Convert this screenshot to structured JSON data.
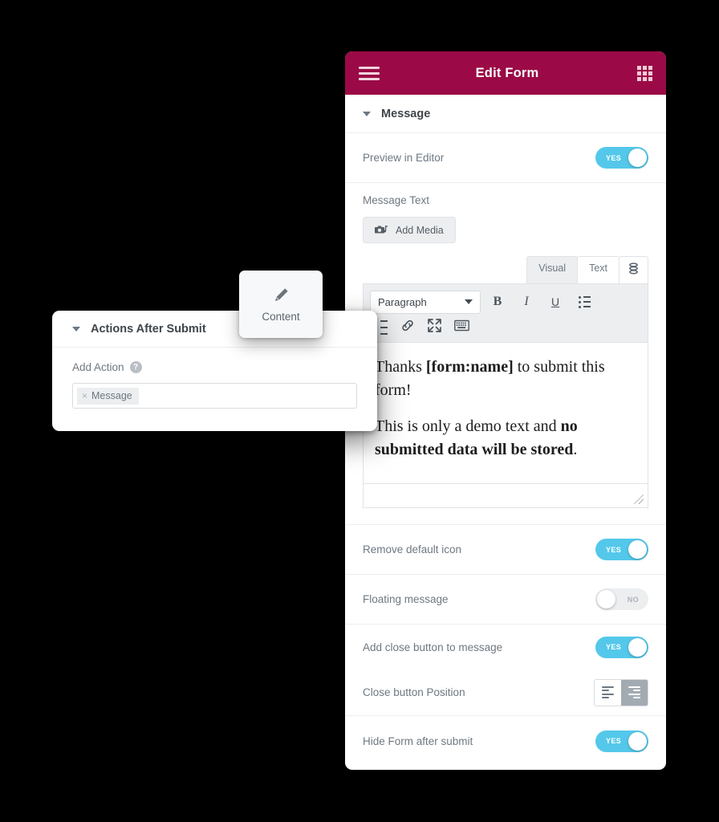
{
  "panel": {
    "header": {
      "title": "Edit Form",
      "menu_icon": "hamburger-icon",
      "apps_icon": "grid-icon",
      "bg_color": "#9b0a46"
    },
    "section": {
      "label": "Message",
      "expanded": true
    },
    "rows": {
      "preview_in_editor": {
        "label": "Preview in Editor",
        "toggle": "YES",
        "state": "on"
      },
      "remove_default_icon": {
        "label": "Remove default icon",
        "toggle": "YES",
        "state": "on"
      },
      "floating_message": {
        "label": "Floating message",
        "toggle": "NO",
        "state": "off"
      },
      "add_close_button": {
        "label": "Add close button to message",
        "toggle": "YES",
        "state": "on"
      },
      "close_button_position": {
        "label": "Close button Position",
        "options": [
          "align-left",
          "align-right"
        ],
        "selected": "align-right"
      },
      "hide_form_after_submit": {
        "label": "Hide Form after submit",
        "toggle": "YES",
        "state": "on"
      }
    },
    "message_text": {
      "label": "Message Text",
      "add_media_label": "Add Media",
      "add_media_icon": "camera-music-icon",
      "tabs": [
        {
          "label": "Visual",
          "active": true
        },
        {
          "label": "Text",
          "active": false
        }
      ],
      "database_tab_icon": "database-icon",
      "toolbar": {
        "format_select": "Paragraph",
        "bold": "B",
        "italic": "I",
        "underline": "U",
        "bullet_list_icon": "unordered-list-icon",
        "numbered_list_icon": "ordered-list-icon",
        "link_icon": "link-icon",
        "fullscreen_icon": "fullscreen-icon",
        "keyboard_icon": "keyboard-icon"
      },
      "content": {
        "paragraph_1_a": "Thanks ",
        "paragraph_1_b": "[form:name]",
        "paragraph_1_c": " to submit this form!",
        "paragraph_2_a": "This is only a demo text and ",
        "paragraph_2_b": "no submitted data will be stored",
        "paragraph_2_c": "."
      },
      "resize_handle_icon": "resize-grip-icon"
    }
  },
  "left_panel": {
    "title": "Actions After Submit",
    "expanded": true,
    "add_action": {
      "label": "Add Action",
      "help_icon": "help-circle-icon",
      "tokens": [
        {
          "remove": "×",
          "label": "Message"
        }
      ]
    }
  },
  "content_tab": {
    "label": "Content",
    "icon": "pencil-icon"
  },
  "colors": {
    "header_bg": "#9b0a46",
    "toggle_on": "#54c8ea",
    "toggle_off": "#eceef0",
    "label_text": "#6d7882",
    "title_text": "#3f454b"
  }
}
